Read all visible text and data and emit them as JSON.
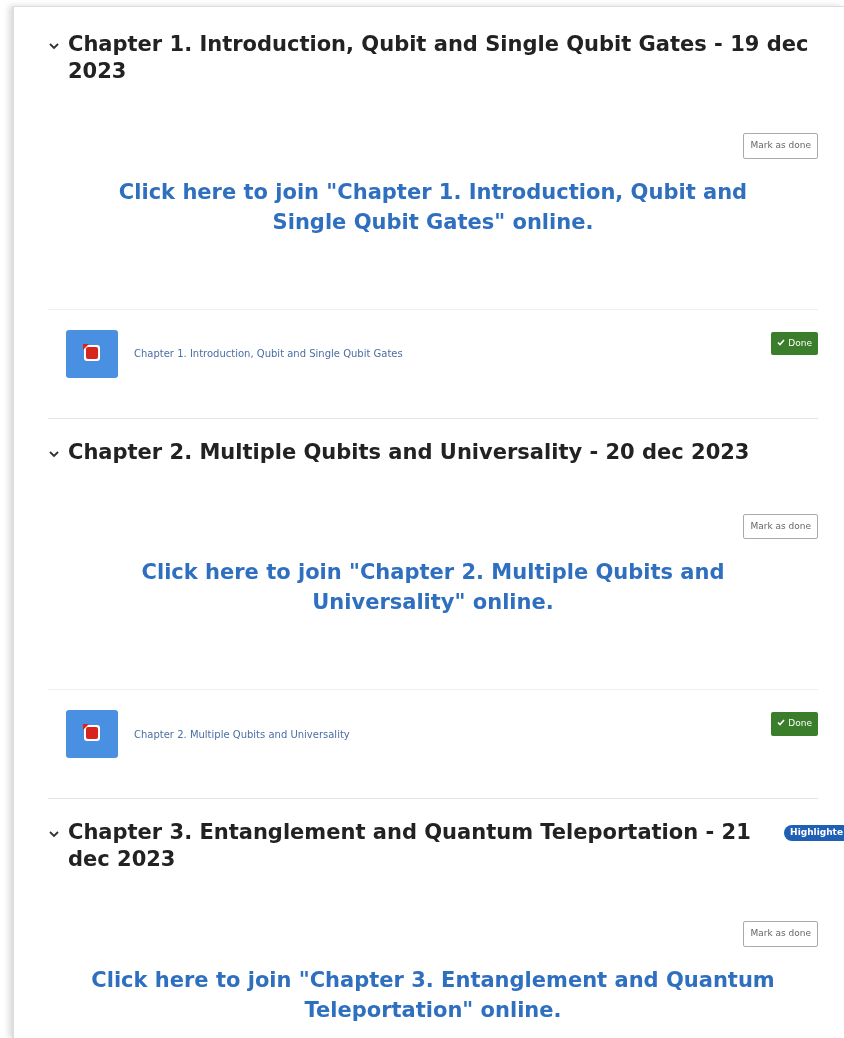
{
  "sections": [
    {
      "title": "Chapter 1. Introduction, Qubit and Single Qubit Gates - 19 dec 2023",
      "expanded": true,
      "mark_button": "Mark as done",
      "join_link": "Click here to join \"Chapter 1. Introduction, Qubit and Single Qubit Gates\" online.",
      "activity": {
        "name": "Chapter 1. Introduction, Qubit and Single Qubit Gates",
        "done": true,
        "status": "Done"
      }
    },
    {
      "title": "Chapter 2. Multiple Qubits and Universality - 20 dec 2023",
      "expanded": true,
      "mark_button": "Mark as done",
      "join_link": "Click here to join \"Chapter 2. Multiple Qubits and Universality\" online.",
      "activity": {
        "name": "Chapter 2. Multiple Qubits and Universality",
        "done": true,
        "status": "Done"
      }
    },
    {
      "title": "Chapter 3. Entanglement and Quantum Teleportation - 21 dec 2023",
      "expanded": true,
      "badge": "Highlighte",
      "mark_button": "Mark as done",
      "join_link": "Click here to join \"Chapter 3. Entanglement and Quantum Teleportation\" online."
    }
  ]
}
